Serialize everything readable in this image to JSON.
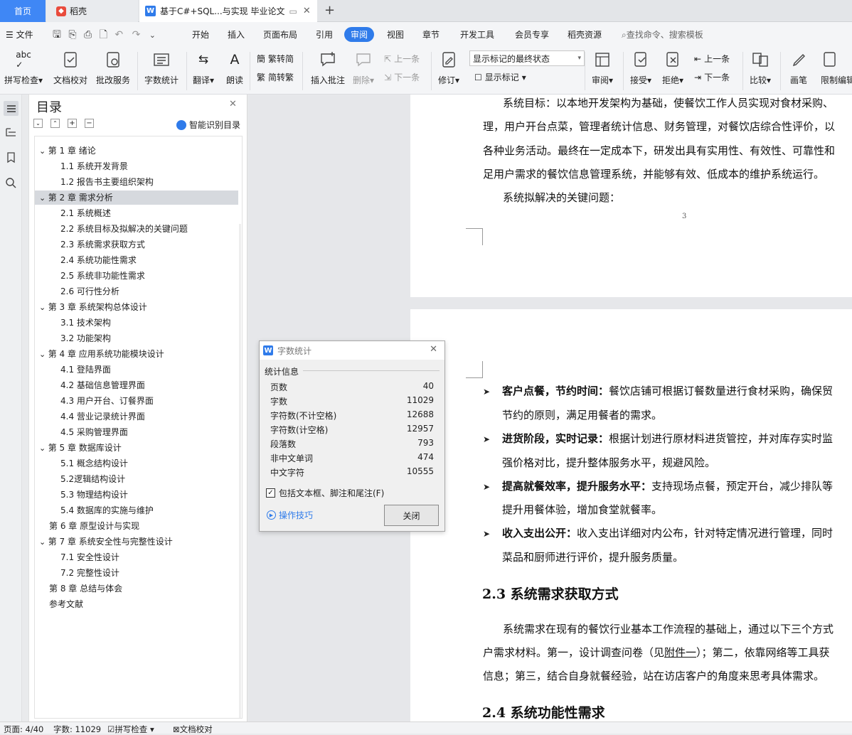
{
  "tabs": {
    "home": "首页",
    "daoke": "稻壳",
    "doc": "基于C#+SQL...与实现 毕业论文"
  },
  "menu": {
    "file": "文件",
    "items": [
      "开始",
      "插入",
      "页面布局",
      "引用",
      "审阅",
      "视图",
      "章节",
      "开发工具",
      "会员专享",
      "稻壳资源"
    ],
    "search": "查找命令、搜索模板"
  },
  "ribbon": {
    "spell": "拼写检查",
    "proofread": "文档校对",
    "revise_service": "批改服务",
    "word_count": "字数统计",
    "translate": "翻译",
    "read_aloud": "朗读",
    "trad_to_simp": "繁转简",
    "simp_to_trad": "简转繁",
    "insert_comment": "插入批注",
    "delete": "删除",
    "prev": "上一条",
    "next": "下一条",
    "track": "修订",
    "display_select": "显示标记的最终状态",
    "show_markup": "显示标记",
    "review": "审阅",
    "accept": "接受",
    "reject": "拒绝",
    "prev2": "上一条",
    "next2": "下一条",
    "compare": "比较",
    "pen": "画笔",
    "restrict": "限制编辑"
  },
  "toc": {
    "title": "目录",
    "smart": "智能识别目录",
    "items": [
      {
        "label": "第 1 章  绪论",
        "level": 1,
        "expand": true
      },
      {
        "label": "1.1  系统开发背景",
        "level": 2
      },
      {
        "label": "1.2  报告书主要组织架构",
        "level": 2
      },
      {
        "label": "第 2 章  需求分析",
        "level": 1,
        "expand": true,
        "selected": true
      },
      {
        "label": "2.1  系统概述",
        "level": 2
      },
      {
        "label": "2.2  系统目标及拟解决的关键问题",
        "level": 2
      },
      {
        "label": "2.3  系统需求获取方式",
        "level": 2
      },
      {
        "label": "2.4  系统功能性需求",
        "level": 2
      },
      {
        "label": "2.5  系统非功能性需求",
        "level": 2
      },
      {
        "label": "2.6  可行性分析",
        "level": 2
      },
      {
        "label": "第 3 章  系统架构总体设计",
        "level": 1,
        "expand": true
      },
      {
        "label": "3.1  技术架构",
        "level": 2
      },
      {
        "label": "3.2  功能架构",
        "level": 2
      },
      {
        "label": "第 4 章  应用系统功能模块设计",
        "level": 1,
        "expand": true
      },
      {
        "label": "4.1  登陆界面",
        "level": 2
      },
      {
        "label": "4.2  基础信息管理界面",
        "level": 2
      },
      {
        "label": "4.3  用户开台、订餐界面",
        "level": 2
      },
      {
        "label": "4.4  营业记录统计界面",
        "level": 2
      },
      {
        "label": "4.5  采购管理界面",
        "level": 2
      },
      {
        "label": "第 5 章  数据库设计",
        "level": 1,
        "expand": true
      },
      {
        "label": "5.1  概念结构设计",
        "level": 2
      },
      {
        "label": "5.2逻辑结构设计",
        "level": 2
      },
      {
        "label": "5.3  物理结构设计",
        "level": 2
      },
      {
        "label": "5.4  数据库的实施与维护",
        "level": 2
      },
      {
        "label": "第 6 章  原型设计与实现",
        "level": 1
      },
      {
        "label": "第 7 章  系统安全性与完整性设计",
        "level": 1,
        "expand": true
      },
      {
        "label": "7.1  安全性设计",
        "level": 2
      },
      {
        "label": "7.2  完整性设计",
        "level": 2
      },
      {
        "label": "第 8 章  总结与体会",
        "level": 1
      },
      {
        "label": "参考文献",
        "level": 1
      }
    ]
  },
  "doc": {
    "p1": [
      "系统目标：以本地开发架构为基础，使餐饮工作人员实现对食材采购、",
      "理，用户开台点菜，管理者统计信息、财务管理，对餐饮店综合性评价，以",
      "各种业务活动。最终在一定成本下，研发出具有实用性、有效性、可靠性和",
      "足用户需求的餐饮信息管理系统，并能够有效、低成本的维护系统运行。",
      "系统拟解决的关键问题："
    ],
    "page_num": "3",
    "bullets": [
      {
        "bold": "客户点餐，节约时间：",
        "text": "餐饮店铺可根据订餐数量进行食材采购，确保贸",
        "cont": "节约的原则，满足用餐者的需求。"
      },
      {
        "bold": "进货阶段，实时记录：",
        "text": "根据计划进行原材料进货管控，并对库存实时监",
        "cont": "强价格对比，提升整体服务水平，规避风险。"
      },
      {
        "bold": "提高就餐效率，提升服务水平：",
        "text": "支持现场点餐，预定开台，减少排队等",
        "cont": "提升用餐体验，增加食堂就餐率。"
      },
      {
        "bold": "收入支出公开：",
        "text": "收入支出详细对内公布，针对特定情况进行管理，同时",
        "cont": "菜品和厨师进行评价，提升服务质量。"
      }
    ],
    "h23": "2.3  系统需求获取方式",
    "p2a": "系统需求在现有的餐饮行业基本工作流程的基础上，通过以下三个方式",
    "p2b_pre": "户需求材料。第一，设计调查问卷（见",
    "p2b_link": "附件一",
    "p2b_post": "）；第二，依靠网络等工具获",
    "p2c": "信息；第三，结合自身就餐经验，站在访店客户的角度来思考具体需求。",
    "h24": "2.4  系统功能性需求"
  },
  "dialog": {
    "title": "字数统计",
    "section": "统计信息",
    "rows": [
      {
        "label": "页数",
        "value": "40"
      },
      {
        "label": "字数",
        "value": "11029"
      },
      {
        "label": "字符数(不计空格)",
        "value": "12688"
      },
      {
        "label": "字符数(计空格)",
        "value": "12957"
      },
      {
        "label": "段落数",
        "value": "793"
      },
      {
        "label": "非中文单词",
        "value": "474"
      },
      {
        "label": "中文字符",
        "value": "10555"
      }
    ],
    "checkbox": "包括文本框、脚注和尾注(F)",
    "tips": "操作技巧",
    "close": "关闭"
  },
  "status": {
    "page": "页面: 4/40",
    "words": "字数: 11029",
    "spell": "拼写检查",
    "proof": "文档校对"
  }
}
